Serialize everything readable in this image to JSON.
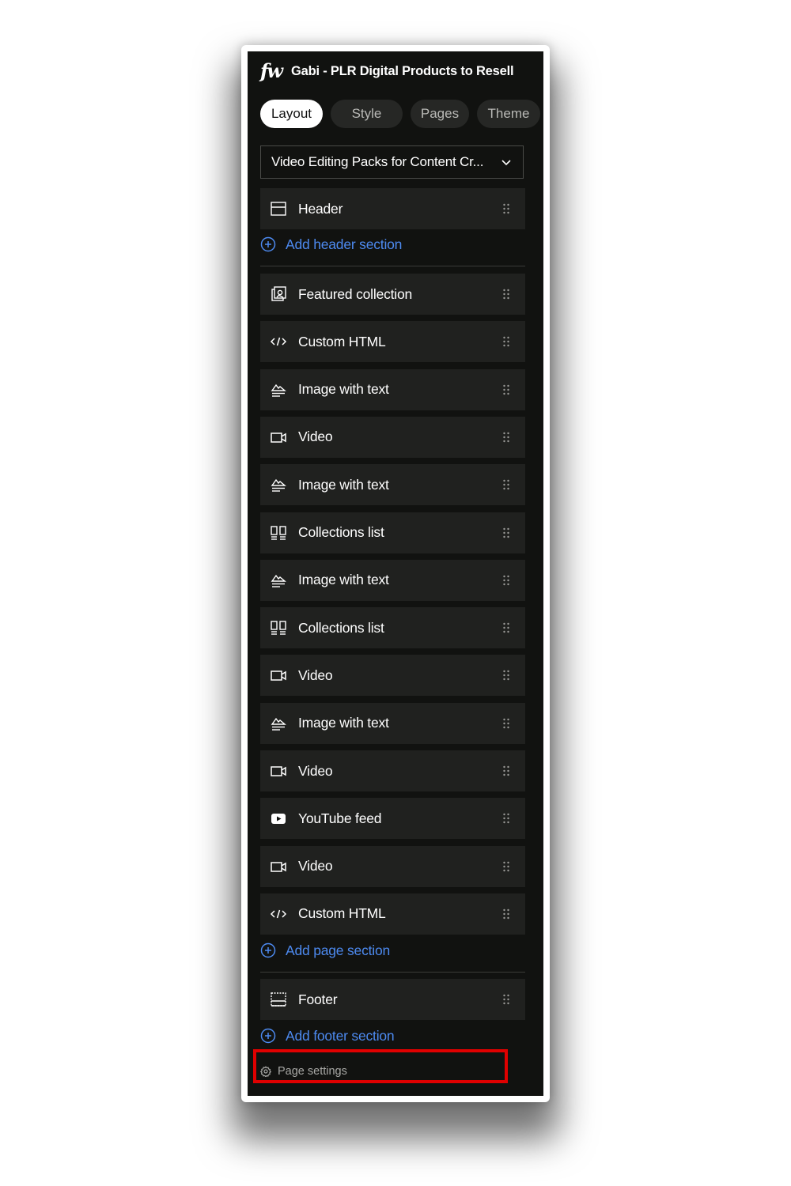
{
  "app": {
    "logo_text": "fw",
    "title": "Gabi - PLR Digital Products to Resell"
  },
  "tabs": [
    {
      "label": "Layout",
      "active": true
    },
    {
      "label": "Style",
      "active": false
    },
    {
      "label": "Pages",
      "active": false
    },
    {
      "label": "Theme",
      "active": false
    }
  ],
  "page_selector": {
    "selected": "Video Editing Packs for Content Cr..."
  },
  "header_section": {
    "label": "Header",
    "icon": "header-layout-icon"
  },
  "add_header": {
    "label": "Add header section",
    "icon": "plus-circle-icon"
  },
  "sections": [
    {
      "label": "Featured collection",
      "icon": "featured-collection-icon"
    },
    {
      "label": "Custom HTML",
      "icon": "code-icon"
    },
    {
      "label": "Image with text",
      "icon": "image-with-text-icon"
    },
    {
      "label": "Video",
      "icon": "video-camera-icon"
    },
    {
      "label": "Image with text",
      "icon": "image-with-text-icon"
    },
    {
      "label": "Collections list",
      "icon": "collections-list-icon"
    },
    {
      "label": "Image with text",
      "icon": "image-with-text-icon"
    },
    {
      "label": "Collections list",
      "icon": "collections-list-icon"
    },
    {
      "label": "Video",
      "icon": "video-camera-icon"
    },
    {
      "label": "Image with text",
      "icon": "image-with-text-icon"
    },
    {
      "label": "Video",
      "icon": "video-camera-icon"
    },
    {
      "label": "YouTube feed",
      "icon": "youtube-icon"
    },
    {
      "label": "Video",
      "icon": "video-camera-icon"
    },
    {
      "label": "Custom HTML",
      "icon": "code-icon"
    }
  ],
  "add_page": {
    "label": "Add page section",
    "icon": "plus-circle-icon"
  },
  "footer_section": {
    "label": "Footer",
    "icon": "footer-layout-icon"
  },
  "add_footer": {
    "label": "Add footer section",
    "icon": "plus-circle-icon"
  },
  "page_settings": {
    "label": "Page settings",
    "icon": "gear-icon"
  },
  "colors": {
    "panel_bg": "#111210",
    "row_bg": "#20211f",
    "link_blue": "#4d8af0",
    "highlight_red": "#e00000"
  }
}
